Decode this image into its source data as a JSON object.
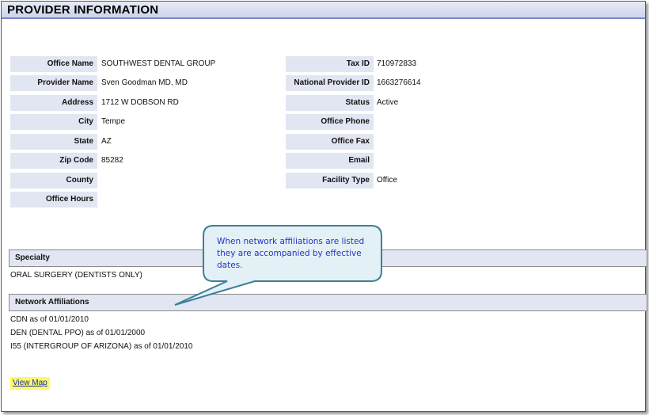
{
  "header": {
    "title": "PROVIDER INFORMATION"
  },
  "left_fields": [
    {
      "label": "Office Name",
      "value": "SOUTHWEST DENTAL GROUP"
    },
    {
      "label": "Provider Name",
      "value": "Sven Goodman MD, MD"
    },
    {
      "label": "Address",
      "value": "1712 W DOBSON RD"
    },
    {
      "label": "City",
      "value": "Tempe"
    },
    {
      "label": "State",
      "value": "AZ"
    },
    {
      "label": "Zip Code",
      "value": "85282"
    },
    {
      "label": "County",
      "value": ""
    },
    {
      "label": "Office Hours",
      "value": ""
    }
  ],
  "right_fields": [
    {
      "label": "Tax ID",
      "value": "710972833"
    },
    {
      "label": "National Provider ID",
      "value": "1663276614"
    },
    {
      "label": "Status",
      "value": "Active"
    },
    {
      "label": "Office Phone",
      "value": ""
    },
    {
      "label": "Office Fax",
      "value": ""
    },
    {
      "label": "Email",
      "value": ""
    },
    {
      "label": "Facility Type",
      "value": "Office"
    }
  ],
  "specialty": {
    "heading": "Specialty",
    "items": [
      "ORAL SURGERY (DENTISTS ONLY)"
    ]
  },
  "network": {
    "heading": "Network Affiliations",
    "items": [
      "CDN  as of  01/01/2010",
      "DEN  (DENTAL PPO)  as of  01/01/2000",
      "I55  (INTERGROUP OF ARIZONA)  as of  01/01/2010"
    ]
  },
  "callout": {
    "text": "When network affiliations are listed they are accompanied by effective dates."
  },
  "links": {
    "view_map": "View Map"
  },
  "colors": {
    "label_bg": "#e1e6f2",
    "title_border": "#7b86c4",
    "link_highlight": "#fafa6a",
    "callout_fill": "#e3f0f5",
    "callout_stroke": "#3e7f97",
    "callout_text": "#2433c4"
  }
}
